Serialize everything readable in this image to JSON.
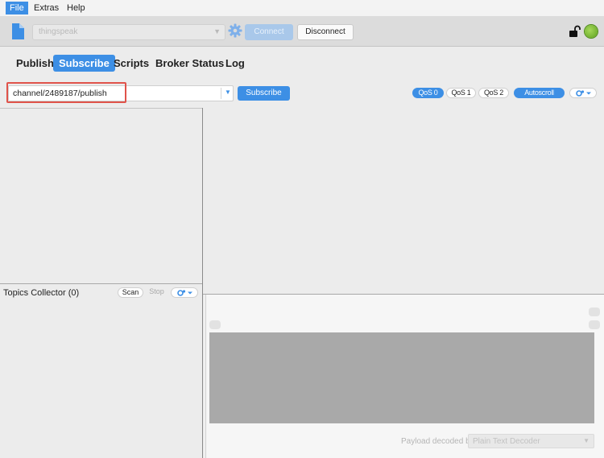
{
  "menu": {
    "items": [
      {
        "label": "File",
        "active": true
      },
      {
        "label": "Extras",
        "active": false
      },
      {
        "label": "Help",
        "active": false
      }
    ]
  },
  "connection": {
    "profile": "thingspeak",
    "connect_label": "Connect",
    "disconnect_label": "Disconnect",
    "status_color": "#6fb42c"
  },
  "tabs": [
    {
      "label": "Publish",
      "active": false
    },
    {
      "label": "Subscribe",
      "active": true
    },
    {
      "label": "Scripts",
      "active": false
    },
    {
      "label": "Broker Status",
      "active": false
    },
    {
      "label": "Log",
      "active": false
    }
  ],
  "subscribe": {
    "topic_value": "channel/2489187/publish",
    "subscribe_label": "Subscribe",
    "qos0_label": "QoS 0",
    "qos1_label": "QoS 1",
    "qos2_label": "QoS 2",
    "autoscroll_label": "Autoscroll",
    "selected_qos": "QoS 0",
    "accent_color": "#3d8fe5",
    "highlight_color": "#e0534a"
  },
  "topics_collector": {
    "title": "Topics Collector (0)",
    "scan_label": "Scan",
    "stop_label": "Stop"
  },
  "payload": {
    "decoded_by_label": "Payload decoded by",
    "decoder_value": "Plain Text Decoder"
  }
}
